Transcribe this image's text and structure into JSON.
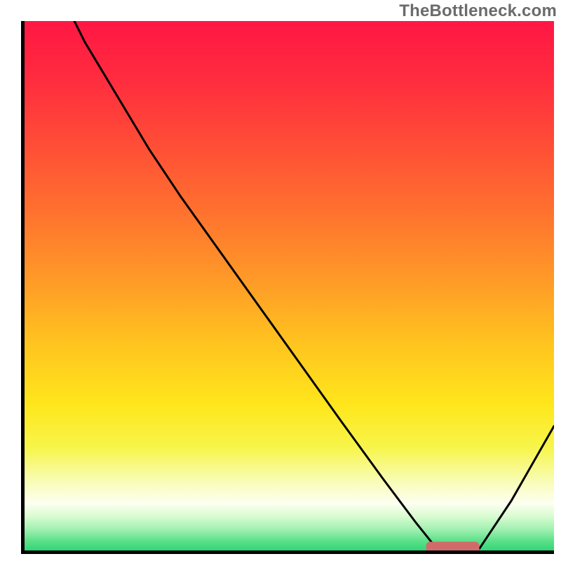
{
  "watermark": "TheBottleneck.com",
  "chart_data": {
    "type": "line",
    "title": "",
    "xlabel": "",
    "ylabel": "",
    "xlim": [
      0,
      100
    ],
    "ylim": [
      0,
      100
    ],
    "x": [
      0,
      6,
      12,
      18,
      24,
      30,
      40,
      50,
      60,
      68,
      74,
      78,
      82,
      86,
      92,
      100
    ],
    "values": [
      120,
      108,
      96,
      86,
      76,
      67,
      53,
      39,
      25,
      14,
      6,
      1,
      0,
      1,
      10,
      24
    ],
    "gradient_stops": [
      {
        "offset": 0.0,
        "color": "#ff1744"
      },
      {
        "offset": 0.1,
        "color": "#ff2a3f"
      },
      {
        "offset": 0.22,
        "color": "#ff4a37"
      },
      {
        "offset": 0.35,
        "color": "#ff6f2f"
      },
      {
        "offset": 0.48,
        "color": "#ff9828"
      },
      {
        "offset": 0.6,
        "color": "#ffc21f"
      },
      {
        "offset": 0.72,
        "color": "#ffe61c"
      },
      {
        "offset": 0.8,
        "color": "#f7f54a"
      },
      {
        "offset": 0.86,
        "color": "#f8fcb0"
      },
      {
        "offset": 0.905,
        "color": "#fdfff1"
      },
      {
        "offset": 0.93,
        "color": "#d8fbd0"
      },
      {
        "offset": 0.955,
        "color": "#9df0af"
      },
      {
        "offset": 0.975,
        "color": "#5ee08a"
      },
      {
        "offset": 1.0,
        "color": "#1fd470"
      }
    ],
    "marker": {
      "x_start": 76,
      "x_end": 86,
      "y": 1.2,
      "thickness": 2.2,
      "color": "#d06b6b"
    }
  }
}
